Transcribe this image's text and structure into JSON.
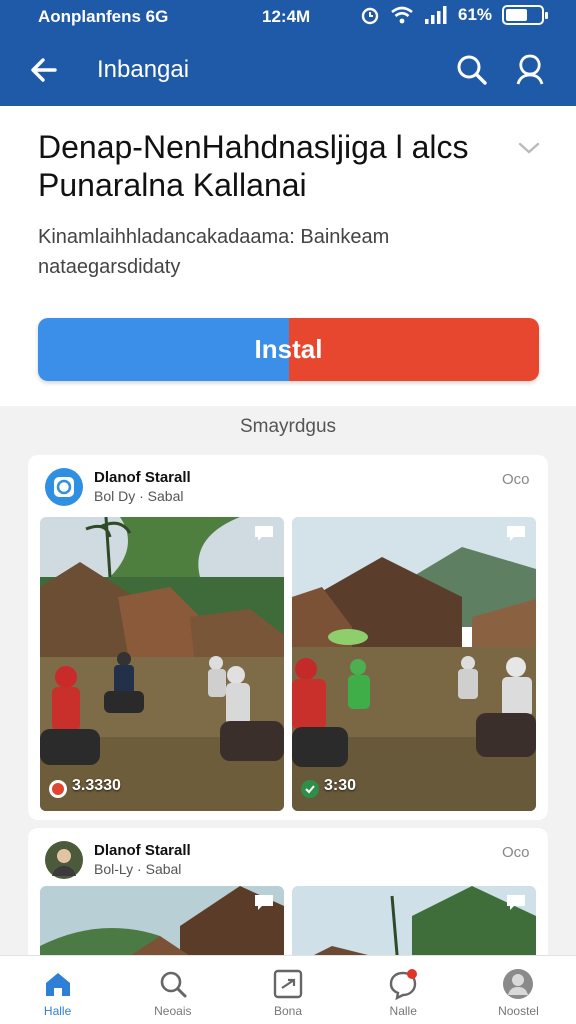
{
  "status_bar": {
    "carrier": "Aonplanfens 6G",
    "time": "12:4M",
    "battery_pct": "61%",
    "battery_level": 0.61
  },
  "app_bar": {
    "title": "Inbangai"
  },
  "app_details": {
    "title": "Denap-NenHahdnasljiga l alcs Punaralna Kallanai",
    "description": "Kinamlaihhladancakadaama: Bainkeam nataegarsdidaty",
    "install_label": "Instal"
  },
  "section_label": "Smayrdgus",
  "posts": [
    {
      "name": "Dlanof Starall",
      "meta": "Bol Dy · Sabal",
      "more": "Oco",
      "photos": [
        {
          "count": "3.3330"
        },
        {
          "count": "3:30"
        }
      ]
    },
    {
      "name": "Dlanof Starall",
      "meta": "Bol-Ly · Sabal",
      "more": "Oco"
    }
  ],
  "bottom_nav": [
    {
      "label": "Halle",
      "icon": "home-icon"
    },
    {
      "label": "Neoais",
      "icon": "search-icon"
    },
    {
      "label": "Bona",
      "icon": "compose-icon"
    },
    {
      "label": "Nalle",
      "icon": "notification-icon"
    },
    {
      "label": "Noostel",
      "icon": "profile-icon"
    }
  ],
  "colors": {
    "header_blue": "#1f5aa8",
    "install_blue": "#3b8fe8",
    "install_red": "#e8472f",
    "nav_active": "#2f7fd6"
  }
}
